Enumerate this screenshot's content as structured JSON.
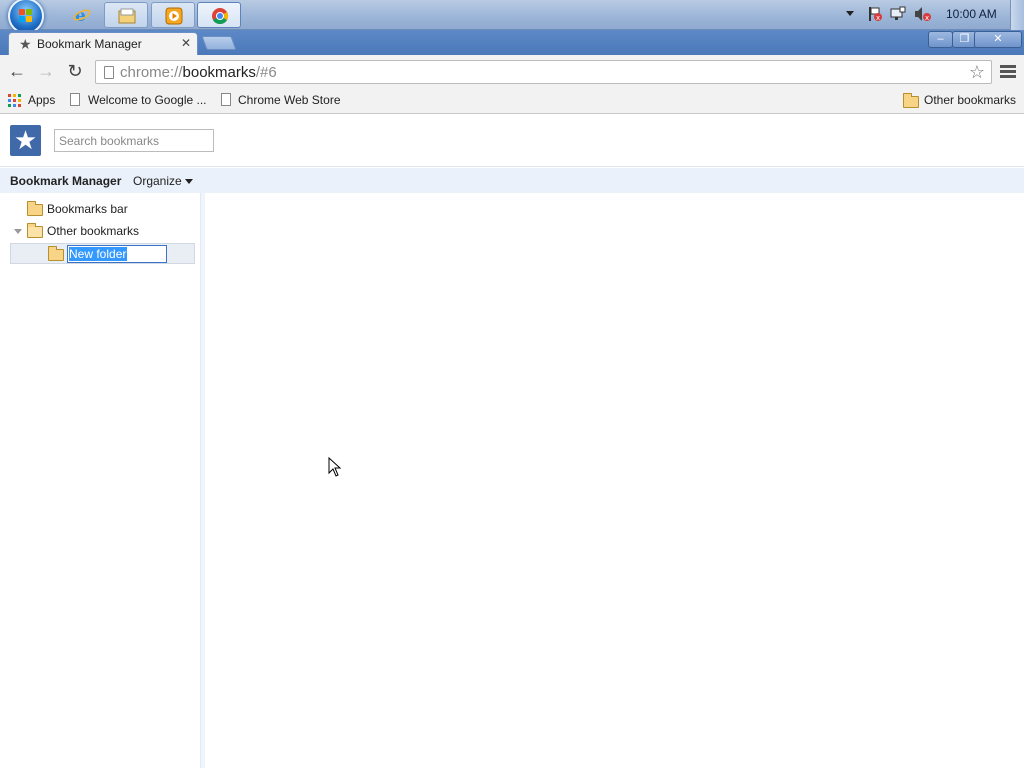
{
  "taskbar": {
    "clock": "10:00 AM",
    "apps": [
      "internet-explorer",
      "windows-explorer",
      "media-player",
      "chrome"
    ]
  },
  "browser": {
    "tab_title": "Bookmark Manager",
    "url_scheme": "chrome://",
    "url_host": "bookmarks",
    "url_path": "/#6"
  },
  "bookmarks_bar": {
    "apps_label": "Apps",
    "items": [
      "Welcome to Google ...",
      "Chrome Web Store"
    ],
    "other_label": "Other bookmarks"
  },
  "manager": {
    "search_placeholder": "Search bookmarks",
    "title": "Bookmark Manager",
    "organize_label": "Organize",
    "tree": {
      "bookmarks_bar": "Bookmarks bar",
      "other_bookmarks": "Other bookmarks",
      "new_folder": "New folder"
    }
  },
  "colors": {
    "taskbar": "#9db6d8",
    "titlebar": "#4a78b9",
    "toolbar": "#f2f2f2",
    "subbar": "#ebf1fb",
    "selection": "#3399ff",
    "folder": "#f7d486"
  }
}
